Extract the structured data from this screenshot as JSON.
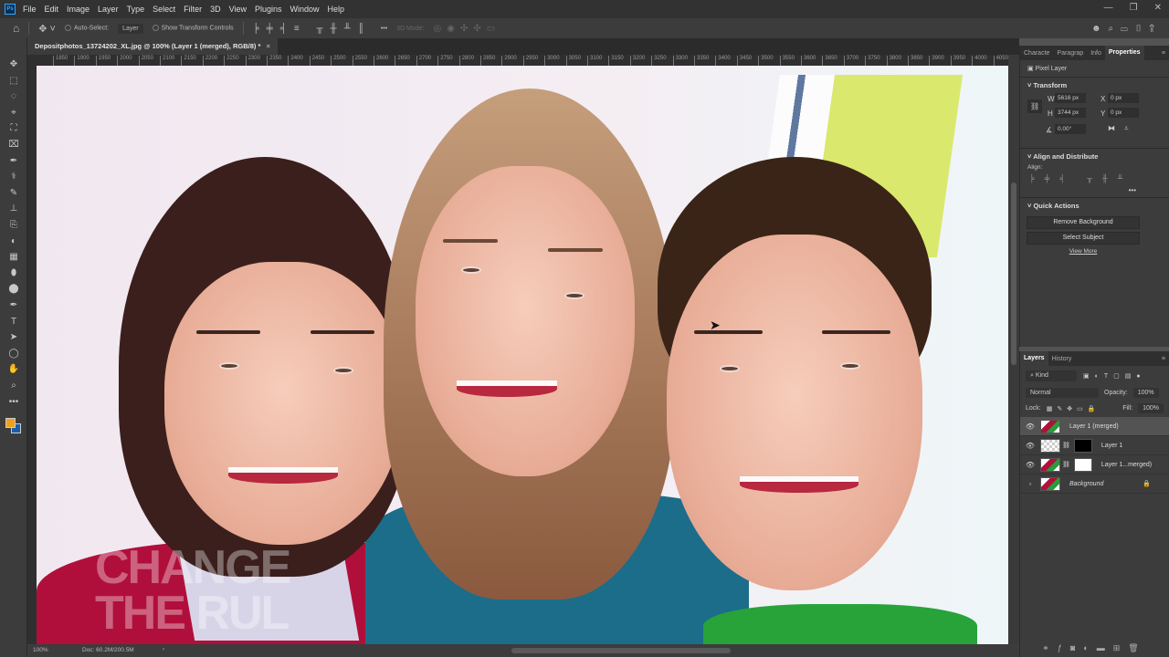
{
  "app": {
    "logo": "Ps",
    "menu": [
      "File",
      "Edit",
      "Image",
      "Layer",
      "Type",
      "Select",
      "Filter",
      "3D",
      "View",
      "Plugins",
      "Window",
      "Help"
    ],
    "window_controls": [
      "—",
      "❐",
      "✕"
    ]
  },
  "options": {
    "auto_select_label": "Auto-Select:",
    "auto_select_value": "Layer",
    "show_transform_label": "Show Transform Controls",
    "mode_3d_label": "3D Mode:",
    "more": "•••"
  },
  "document": {
    "tab_title": "Depositphotos_13724202_XL.jpg @ 100% (Layer 1 (merged), RGB/8) *",
    "close": "×"
  },
  "ruler": {
    "start": 1850,
    "step": 50,
    "end": 4100
  },
  "canvas": {
    "watermark_lines": [
      "CHANGE",
      "THE RUL"
    ]
  },
  "status": {
    "zoom": "100%",
    "doc": "Doc: 60.2M/200.5M",
    "arrow": "›"
  },
  "properties": {
    "tabs": [
      "Characte",
      "Paragrap",
      "Info",
      "Properties"
    ],
    "active_tab": "Properties",
    "layer_type": "Pixel Layer",
    "transform_title": "Transform",
    "w_label": "W",
    "w": "5616 px",
    "h_label": "H",
    "h": "3744 px",
    "x_label": "X",
    "x": "0 px",
    "y_label": "Y",
    "y": "0 px",
    "angle": "0.00°",
    "align_title": "Align and Distribute",
    "align_label": "Align:",
    "more": "•••",
    "quick_title": "Quick Actions",
    "remove_bg": "Remove Background",
    "select_subject": "Select Subject",
    "view_more": "View More"
  },
  "layers": {
    "tabs": [
      "Layers",
      "History"
    ],
    "kind": "Kind",
    "blend": "Normal",
    "opacity_label": "Opacity:",
    "opacity": "100%",
    "lock_label": "Lock:",
    "fill_label": "Fill:",
    "fill": "100%",
    "items": [
      {
        "name": "Layer 1 (merged)",
        "visible": true,
        "selected": true
      },
      {
        "name": "Layer 1",
        "visible": true,
        "mask": "black"
      },
      {
        "name": "Layer 1...merged)",
        "visible": true,
        "mask": "white"
      },
      {
        "name": "Background",
        "visible": false,
        "locked": true
      }
    ]
  }
}
